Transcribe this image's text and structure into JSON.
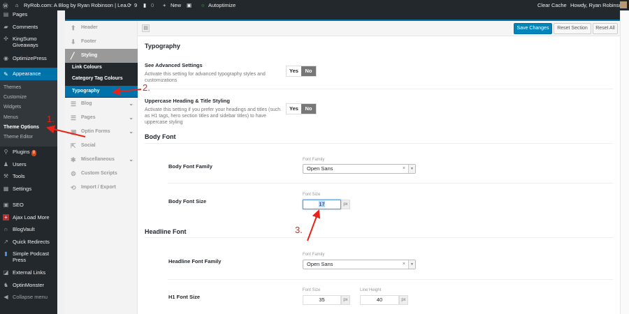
{
  "admin_bar": {
    "site_title": "RyRob.com: A Blog by Ryan Robinson | Lea...",
    "updates": "9",
    "comments": "0",
    "new_label": "New",
    "autoptimize": "Autoptimize",
    "clear_cache": "Clear Cache",
    "howdy": "Howdy, Ryan Robinson"
  },
  "wp_menu": {
    "items": [
      "Pages",
      "Comments",
      "KingSumo Giveaways",
      "OptimizePress",
      "Appearance",
      "Plugins",
      "Users",
      "Tools",
      "Settings",
      "SEO",
      "Ajax Load More",
      "BlogVault",
      "Quick Redirects",
      "Simple Podcast Press",
      "External Links",
      "OptinMonster",
      "Collapse menu"
    ],
    "appearance_sub": [
      "Themes",
      "Customize",
      "Widgets",
      "Menus",
      "Theme Options",
      "Theme Editor"
    ],
    "plugins_badge": "8",
    "accent": "#0073aa"
  },
  "options_nav": {
    "items": [
      "Header",
      "Footer",
      "Styling",
      "Blog",
      "Pages",
      "Optin Forms",
      "Social",
      "Miscellaneous",
      "Custom Scripts",
      "Import / Export"
    ],
    "styling_sub": [
      "Link Colours",
      "Category Tag Colours",
      "Typography"
    ]
  },
  "toolbar": {
    "save": "Save Changes",
    "reset_section": "Reset Section",
    "reset_all": "Reset All"
  },
  "content": {
    "title": "Typography",
    "advanced": {
      "label": "See Advanced Settings",
      "desc": "Activate this setting for advanced typography styles and customizations",
      "yes": "Yes",
      "no": "No"
    },
    "uppercase": {
      "label": "Uppercase Heading & Title Styling",
      "desc": "Activate this setting if you prefer your headings and titles (such as H1 tags, hero section titles and sidebar titles) to have uppercase styling",
      "yes": "Yes",
      "no": "No"
    },
    "body_font": {
      "heading": "Body Font",
      "family_label": "Body Font Family",
      "family_small": "Font Family",
      "family_value": "Open Sans",
      "size_label": "Body Font Size",
      "size_small": "Font Size",
      "size_value": "17",
      "unit": "px"
    },
    "headline_font": {
      "heading": "Headline Font",
      "family_label": "Headline Font Family",
      "family_small": "Font Family",
      "family_value": "Open Sans",
      "h1_label": "H1 Font Size",
      "size_small": "Font Size",
      "size_value": "35",
      "lh_small": "Line Height",
      "lh_value": "40",
      "unit": "px"
    }
  },
  "annotations": {
    "step1": "1.",
    "step2": "2.",
    "step3": "3."
  }
}
